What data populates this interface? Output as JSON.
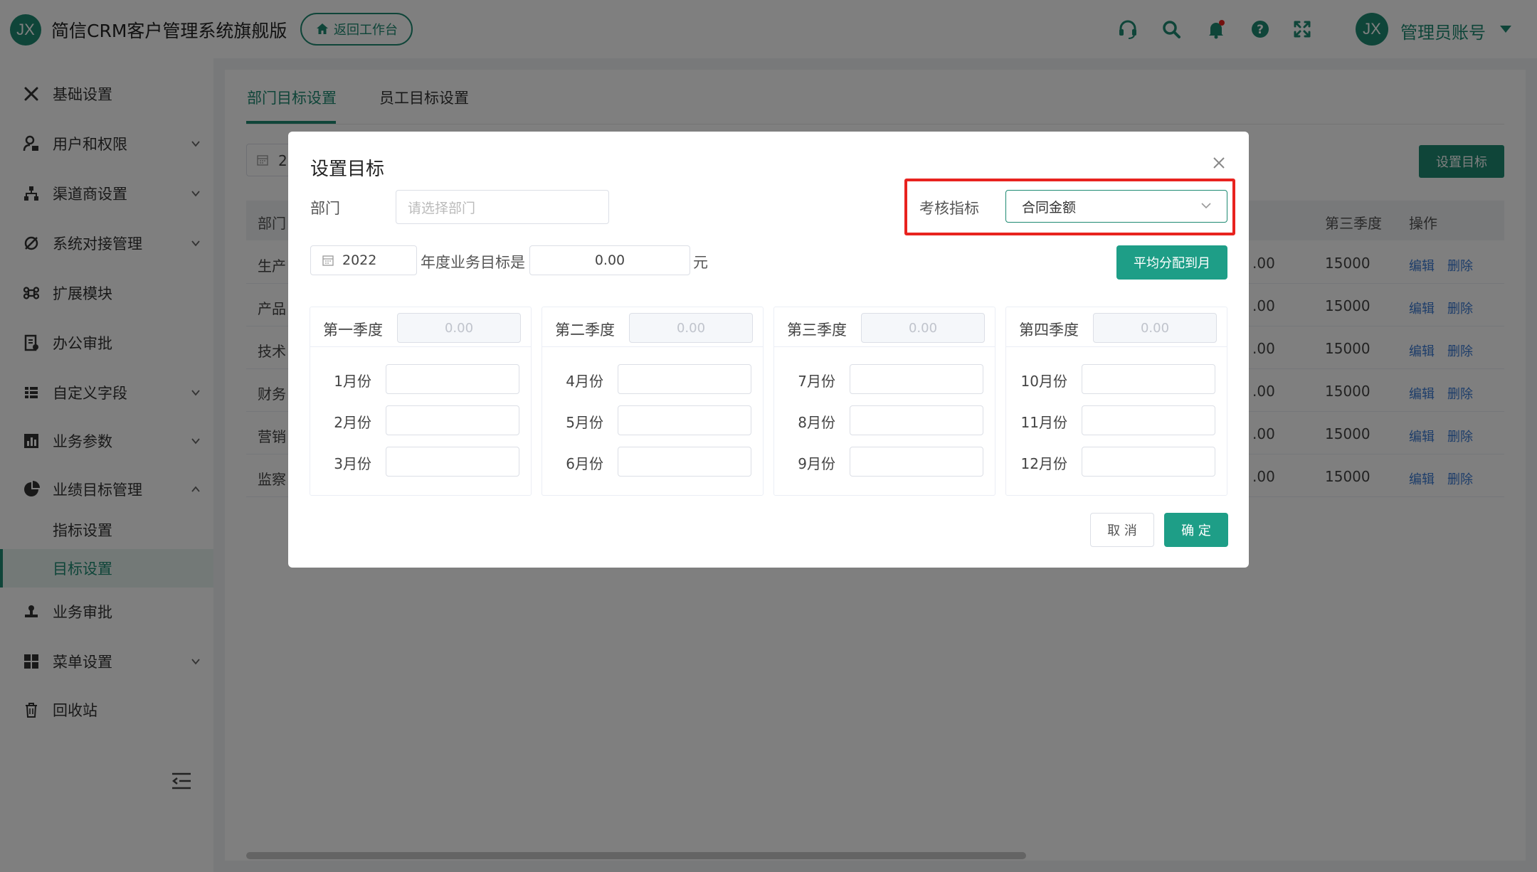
{
  "header": {
    "logo": "JX",
    "app_title": "简信CRM客户管理系统旗舰版",
    "back_label": "返回工作台",
    "avatar": "JX",
    "admin_name": "管理员账号"
  },
  "sidebar": {
    "items": [
      {
        "label": "基础设置"
      },
      {
        "label": "用户和权限"
      },
      {
        "label": "渠道商设置"
      },
      {
        "label": "系统对接管理"
      },
      {
        "label": "扩展模块"
      },
      {
        "label": "办公审批"
      },
      {
        "label": "自定义字段"
      },
      {
        "label": "业务参数"
      },
      {
        "label": "业绩目标管理"
      },
      {
        "label": "业务审批"
      },
      {
        "label": "菜单设置"
      },
      {
        "label": "回收站"
      }
    ],
    "sub_items": [
      {
        "label": "指标设置"
      },
      {
        "label": "目标设置"
      }
    ]
  },
  "main": {
    "tabs": [
      "部门目标设置",
      "员工目标设置"
    ],
    "year_partial": "2",
    "set_target_label": "设置目标",
    "columns": {
      "dept": "部门",
      "q3": "第三季度",
      "ops": "操作"
    },
    "rows": [
      {
        "dept": "生产",
        "amount": ".00",
        "q3": "15000"
      },
      {
        "dept": "产品",
        "amount": ".00",
        "q3": "15000"
      },
      {
        "dept": "技术",
        "amount": ".00",
        "q3": "15000"
      },
      {
        "dept": "财务",
        "amount": ".00",
        "q3": "15000"
      },
      {
        "dept": "营销",
        "amount": ".00",
        "q3": "15000"
      },
      {
        "dept": "监察",
        "amount": ".00",
        "q3": "15000"
      }
    ],
    "edit_label": "编辑",
    "delete_label": "删除"
  },
  "dialog": {
    "title": "设置目标",
    "dept_label": "部门",
    "dept_placeholder": "请选择部门",
    "metric_label": "考核指标",
    "metric_value": "合同金额",
    "year": "2022",
    "annual_label": "年度业务目标是",
    "annual_value": "0.00",
    "unit": "元",
    "avg_label": "平均分配到月",
    "quarters": [
      {
        "label": "第一季度",
        "total": "0.00",
        "months": [
          "1月份",
          "2月份",
          "3月份"
        ]
      },
      {
        "label": "第二季度",
        "total": "0.00",
        "months": [
          "4月份",
          "5月份",
          "6月份"
        ]
      },
      {
        "label": "第三季度",
        "total": "0.00",
        "months": [
          "7月份",
          "8月份",
          "9月份"
        ]
      },
      {
        "label": "第四季度",
        "total": "0.00",
        "months": [
          "10月份",
          "11月份",
          "12月份"
        ]
      }
    ],
    "cancel_label": "取 消",
    "ok_label": "确 定"
  },
  "colors": {
    "brand": "#1e8a72",
    "highlight": "#e8231f",
    "link": "#3a7bd5"
  }
}
